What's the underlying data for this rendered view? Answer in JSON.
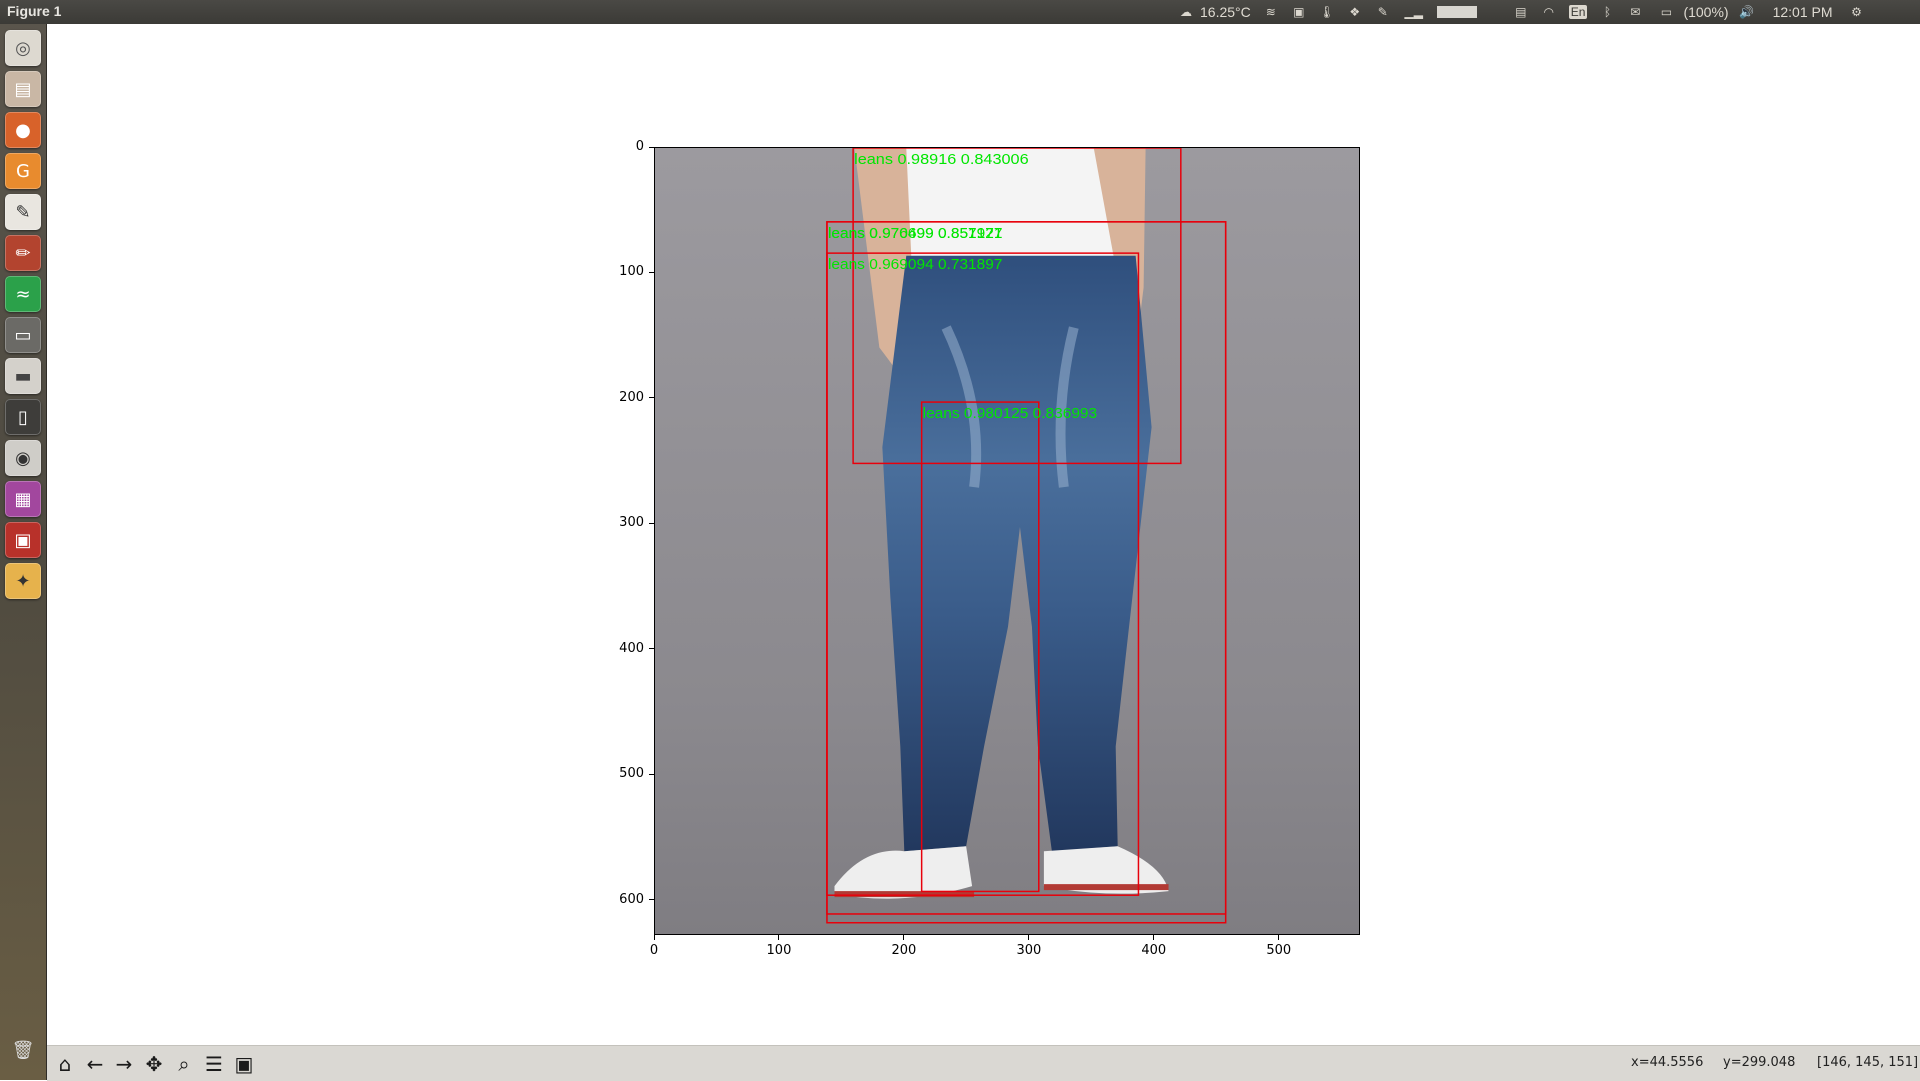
{
  "window": {
    "title": "Figure 1"
  },
  "panel": {
    "weather_temp": "16.25°C",
    "battery": "(100%)",
    "keyboard_layout": "En",
    "clock": "12:01 PM",
    "icons": [
      "weather-icon",
      "network-monitor-icon",
      "system-load-icon",
      "temperature-icon",
      "dropbox-icon",
      "clip-icon",
      "graph-icon",
      "usage-bar-icon",
      "display-icon",
      "wifi-icon",
      "keyboard-icon",
      "bluetooth-icon",
      "mail-icon",
      "battery-icon",
      "volume-icon",
      "gear-icon"
    ]
  },
  "launcher": {
    "apps": [
      "dash-icon",
      "files-icon",
      "firefox-icon",
      "pdf-tool-icon",
      "text-editor-icon",
      "paint-icon",
      "spotify-icon",
      "terminal-icon",
      "scanner-icon",
      "phone-icon",
      "camera-icon",
      "workspace-icon",
      "presentation-icon",
      "compass-icon"
    ],
    "trash": "trash-icon"
  },
  "figure": {
    "x_ticks": [
      "0",
      "100",
      "200",
      "300",
      "400",
      "500"
    ],
    "y_ticks": [
      "0",
      "100",
      "200",
      "300",
      "400",
      "500",
      "600"
    ],
    "image_width": 565,
    "image_height": 628,
    "detections": [
      {
        "label": "leans 0.98916 0.843006",
        "x1": 159,
        "y1": 0,
        "x2": 422,
        "y2": 252
      },
      {
        "label": "leans 0.970499 0.851971",
        "x1": 138,
        "y1": 59,
        "x2": 458,
        "y2": 619
      },
      {
        "label": "leans 0.976699 0.857127",
        "x1": 138,
        "y1": 59,
        "x2": 458,
        "y2": 612
      },
      {
        "label": "leans 0.969094 0.731897",
        "x1": 138,
        "y1": 84,
        "x2": 388,
        "y2": 597
      },
      {
        "label": "leans 0.980125 0.836993",
        "x1": 214,
        "y1": 203,
        "x2": 308,
        "y2": 594
      }
    ],
    "box_color": "#e8000b",
    "label_color": "#00e600"
  },
  "toolbar": {
    "buttons": [
      "home-icon",
      "back-icon",
      "forward-icon",
      "pan-icon",
      "zoom-icon",
      "configure-subplots-icon",
      "save-icon"
    ],
    "status_x": "x=44.5556",
    "status_y": "y=299.048",
    "status_rgb": "[146, 145, 151]"
  }
}
